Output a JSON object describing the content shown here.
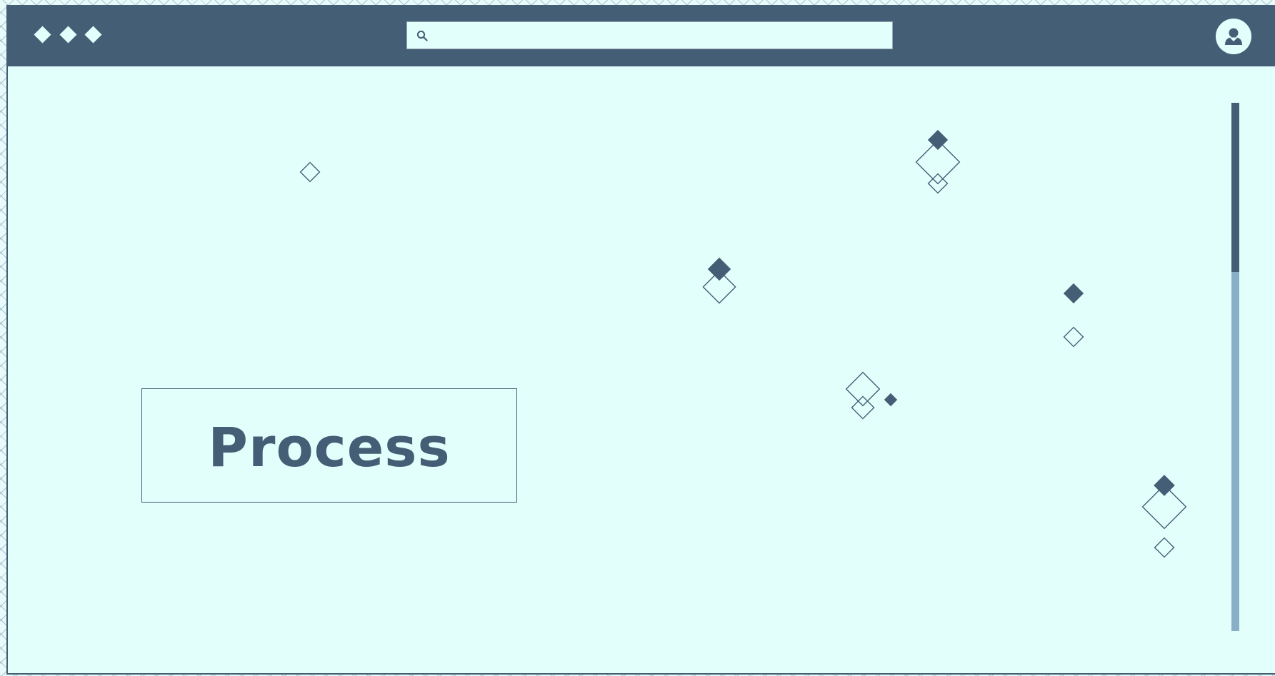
{
  "header": {
    "menu_icons": [
      "diamond-icon",
      "diamond-icon",
      "diamond-icon"
    ],
    "search": {
      "icon": "search-icon",
      "value": "",
      "placeholder": ""
    },
    "profile_icon": "user-avatar-icon"
  },
  "main": {
    "headline": "Process",
    "decoration_icon": "diamond-icon"
  },
  "scrollbar": {
    "position_fraction": 0.0,
    "visible_fraction": 0.32
  },
  "colors": {
    "primary": "#445e76",
    "background": "#e3fffc",
    "scroll_track": "#88afc6"
  }
}
